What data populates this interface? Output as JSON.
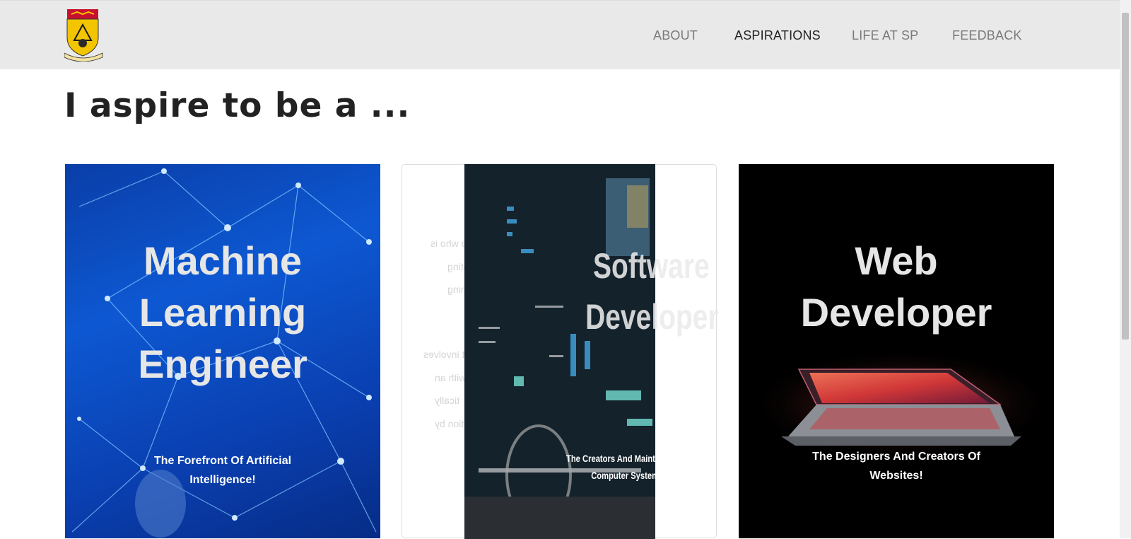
{
  "nav": {
    "logo_alt": "Singapore Polytechnic crest",
    "links": [
      "ABOUT",
      "ASPIRATIONS",
      "LIFE AT SP",
      "FEEDBACK"
    ],
    "active": "ASPIRATIONS"
  },
  "heading": "I aspire to be a ...",
  "cards": [
    {
      "title_lines": [
        "Machine",
        "Learning",
        "Engineer"
      ],
      "subtitle_lines": [
        "The Forefront Of Artificial",
        "Intelligence!"
      ],
      "background": "#0d58d2"
    },
    {
      "title_lines": [
        "Software",
        "Developer"
      ],
      "subtitle_lines": [
        "The Creators And Maint",
        "Computer System"
      ],
      "mirrored_fragments": [
        "o who is",
        "ating",
        "gning",
        "it involves",
        "with an",
        "tically",
        "ution by"
      ],
      "background": "#ffffff"
    },
    {
      "title_lines": [
        "Web",
        "Developer"
      ],
      "subtitle_lines": [
        "The Designers And Creators Of",
        "Websites!"
      ],
      "background": "#000000"
    }
  ],
  "colors": {
    "navbar_bg": "#e9e9e9",
    "nav_text": "#7a7a7a",
    "nav_active": "#222222",
    "heading": "#222222"
  }
}
